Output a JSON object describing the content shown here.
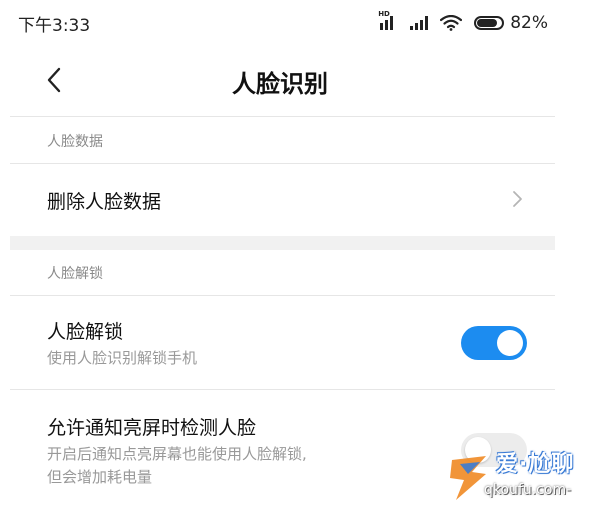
{
  "status_bar": {
    "time": "下午3:33",
    "network_badge": "HD",
    "battery_percent": "82%",
    "battery_level": 0.82
  },
  "header": {
    "title": "人脸识别",
    "back_icon": "chevron-left-icon"
  },
  "sections": {
    "face_data": {
      "header": "人脸数据",
      "delete_label": "删除人脸数据",
      "chevron_icon": "chevron-right-icon"
    },
    "face_unlock": {
      "header": "人脸解锁",
      "unlock_title": "人脸解锁",
      "unlock_subtitle": "使用人脸识别解锁手机",
      "unlock_enabled": true,
      "notify_title": "允许通知亮屏时检测人脸",
      "notify_subtitle_line1": "开启后通知点亮屏幕也能使用人脸解锁,",
      "notify_subtitle_line2": "但会增加耗电量",
      "notify_enabled": false
    }
  },
  "watermark": {
    "text_main": "爱·尬聊",
    "text_url": "qkoufu.com-"
  },
  "colors": {
    "accent": "#1c8cf0",
    "toggle_off": "#ececec",
    "section_text": "#8a8a8a",
    "divider": "#e6e6e6"
  }
}
